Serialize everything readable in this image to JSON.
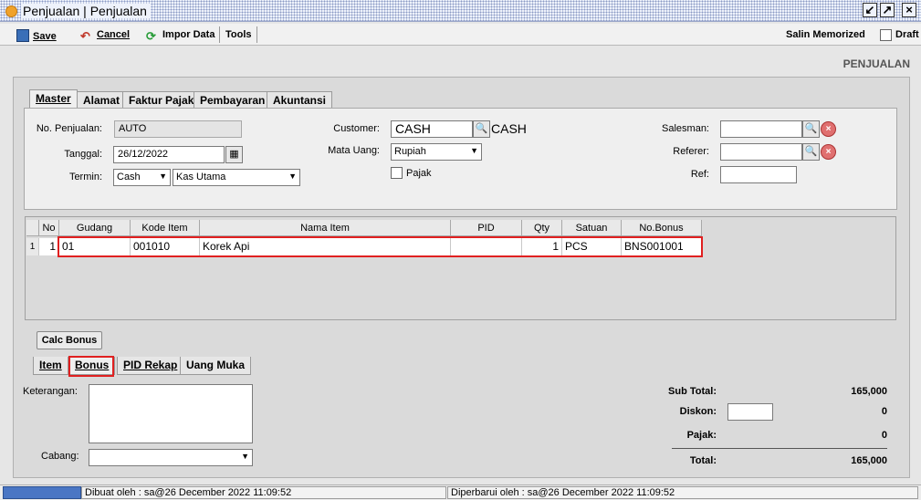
{
  "window": {
    "title": "Penjualan | Penjualan"
  },
  "toolbar": {
    "save": "Save",
    "cancel": "Cancel",
    "import": "Impor Data",
    "tools": "Tools",
    "salin": "Salin Memorized",
    "draft": "Draft"
  },
  "form_title": "PENJUALAN",
  "tabs": [
    "Master",
    "Alamat",
    "Faktur Pajak",
    "Pembayaran",
    "Akuntansi"
  ],
  "master": {
    "no_penjualan_label": "No. Penjualan:",
    "no_penjualan": "AUTO",
    "tanggal_label": "Tanggal:",
    "tanggal": "26/12/2022",
    "termin_label": "Termin:",
    "termin": "Cash",
    "kas": "Kas Utama",
    "customer_label": "Customer:",
    "customer": "CASH",
    "customer_name": "CASH",
    "mata_uang_label": "Mata Uang:",
    "mata_uang": "Rupiah",
    "pajak_label": "Pajak",
    "salesman_label": "Salesman:",
    "referer_label": "Referer:",
    "ref_label": "Ref:"
  },
  "grid": {
    "headers": [
      "No",
      "Gudang",
      "Kode Item",
      "Nama Item",
      "PID",
      "Qty",
      "Satuan",
      "No.Bonus"
    ],
    "rows": [
      {
        "row": "1",
        "no": "1",
        "gudang": "01",
        "kode": "001010",
        "nama": "Korek Api",
        "pid": "",
        "qty": "1",
        "satuan": "PCS",
        "bonus": "BNS001001"
      }
    ]
  },
  "calc_bonus": "Calc Bonus",
  "bottom_tabs": [
    "Item",
    "Bonus",
    "PID Rekap",
    "Uang Muka"
  ],
  "bottom": {
    "keterangan_label": "Keterangan:",
    "cabang_label": "Cabang:"
  },
  "totals": {
    "sub_total_label": "Sub Total:",
    "sub_total": "165,000",
    "diskon_label": "Diskon:",
    "diskon": "0",
    "pajak_label": "Pajak:",
    "pajak": "0",
    "total_label": "Total:",
    "total": "165,000"
  },
  "status": {
    "created": "Dibuat oleh : sa@26 December 2022  11:09:52",
    "updated": "Diperbarui oleh : sa@26 December 2022  11:09:52"
  }
}
